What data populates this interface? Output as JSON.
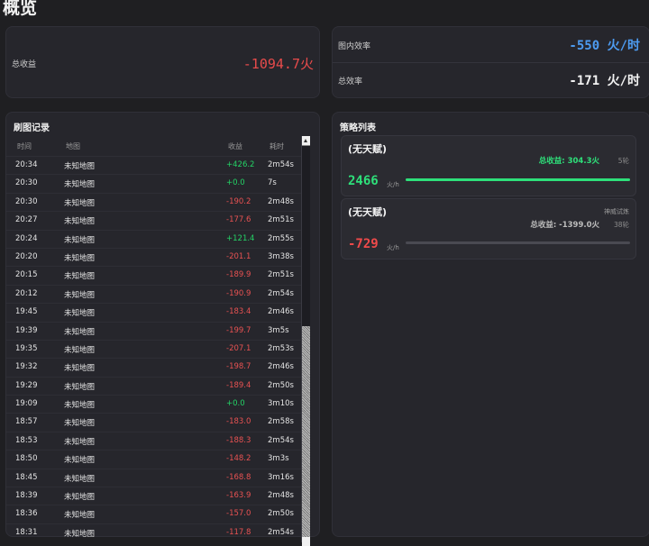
{
  "page": {
    "title": "概览"
  },
  "summary": {
    "total_income_label": "总收益",
    "total_income_value": "-1094.7火",
    "map_eff_label": "图内效率",
    "map_eff_value": "-550 火/时",
    "map_eff_color": "#4d9bf0",
    "total_eff_label": "总效率",
    "total_eff_value": "-171 火/时",
    "total_eff_color": "#f2f2f2"
  },
  "runs": {
    "title": "刷图记录",
    "headers": {
      "time": "时间",
      "map": "地图",
      "income": "收益",
      "duration": "耗时"
    },
    "rows": [
      {
        "time": "20:34",
        "map": "未知地图",
        "income": "+426.2",
        "duration": "2m54s",
        "sign": "pos"
      },
      {
        "time": "20:30",
        "map": "未知地图",
        "income": "+0.0",
        "duration": "7s",
        "sign": "pos"
      },
      {
        "time": "20:30",
        "map": "未知地图",
        "income": "-190.2",
        "duration": "2m48s",
        "sign": "neg"
      },
      {
        "time": "20:27",
        "map": "未知地图",
        "income": "-177.6",
        "duration": "2m51s",
        "sign": "neg"
      },
      {
        "time": "20:24",
        "map": "未知地图",
        "income": "+121.4",
        "duration": "2m55s",
        "sign": "pos"
      },
      {
        "time": "20:20",
        "map": "未知地图",
        "income": "-201.1",
        "duration": "3m38s",
        "sign": "neg"
      },
      {
        "time": "20:15",
        "map": "未知地图",
        "income": "-189.9",
        "duration": "2m51s",
        "sign": "neg"
      },
      {
        "time": "20:12",
        "map": "未知地图",
        "income": "-190.9",
        "duration": "2m54s",
        "sign": "neg"
      },
      {
        "time": "19:45",
        "map": "未知地图",
        "income": "-183.4",
        "duration": "2m46s",
        "sign": "neg"
      },
      {
        "time": "19:39",
        "map": "未知地图",
        "income": "-199.7",
        "duration": "3m5s",
        "sign": "neg"
      },
      {
        "time": "19:35",
        "map": "未知地图",
        "income": "-207.1",
        "duration": "2m53s",
        "sign": "neg"
      },
      {
        "time": "19:32",
        "map": "未知地图",
        "income": "-198.7",
        "duration": "2m46s",
        "sign": "neg"
      },
      {
        "time": "19:29",
        "map": "未知地图",
        "income": "-189.4",
        "duration": "2m50s",
        "sign": "neg"
      },
      {
        "time": "19:09",
        "map": "未知地图",
        "income": "+0.0",
        "duration": "3m10s",
        "sign": "pos"
      },
      {
        "time": "18:57",
        "map": "未知地图",
        "income": "-183.0",
        "duration": "2m58s",
        "sign": "neg"
      },
      {
        "time": "18:53",
        "map": "未知地图",
        "income": "-188.3",
        "duration": "2m54s",
        "sign": "neg"
      },
      {
        "time": "18:50",
        "map": "未知地图",
        "income": "-148.2",
        "duration": "3m3s",
        "sign": "neg"
      },
      {
        "time": "18:45",
        "map": "未知地图",
        "income": "-168.8",
        "duration": "3m16s",
        "sign": "neg"
      },
      {
        "time": "18:39",
        "map": "未知地图",
        "income": "-163.9",
        "duration": "2m48s",
        "sign": "neg"
      },
      {
        "time": "18:36",
        "map": "未知地图",
        "income": "-157.0",
        "duration": "2m50s",
        "sign": "neg"
      },
      {
        "time": "18:31",
        "map": "未知地图",
        "income": "-117.8",
        "duration": "2m54s",
        "sign": "neg"
      }
    ]
  },
  "strategies": {
    "title": "策略列表",
    "items": [
      {
        "name": "(无天赋)",
        "tag": "",
        "total": "总收益: 304.3火",
        "total_color": "#2ee07a",
        "rounds": "5轮",
        "big_value": "2466",
        "big_color": "#2ee07a",
        "unit": "火/h",
        "bar_level": 1.0,
        "bar_color": "#2ee07a"
      },
      {
        "name": "(无天赋)",
        "tag": "神威试炼",
        "total": "总收益: -1399.0火",
        "total_color": "#bdbdbd",
        "rounds": "38轮",
        "big_value": "-729",
        "big_color": "#f04a4a",
        "unit": "火/h",
        "bar_level": 0.0,
        "bar_color": "#6e6e76"
      }
    ]
  }
}
